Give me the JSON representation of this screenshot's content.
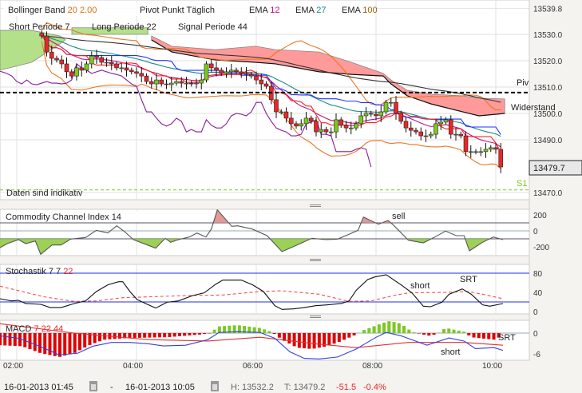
{
  "legend": {
    "bollinger_label": "Bollinger Band",
    "bollinger_period": "20",
    "bollinger_dev": "2.00",
    "pivot_label": "Pivot Punkt  Täglich",
    "ema1_label": "EMA",
    "ema1_value": "12",
    "ema2_label": "EMA",
    "ema2_value": "27",
    "ema3_label": "EMA",
    "ema3_value": "100",
    "short_label": "Short Periode",
    "short_value": "7",
    "long_label": "Long Periode",
    "long_value": "22",
    "signal_label": "Signal Periode",
    "signal_value": "44"
  },
  "annotations": {
    "piv": "Piv",
    "widerstand": "Widerstand",
    "s1": "S1",
    "indicative": "Daten sind indikativ",
    "cci_sell": "sell",
    "stoch_short": "short",
    "stoch_srt": "SRT",
    "macd_srt": "SRT",
    "macd_short": "short"
  },
  "panels": {
    "cci_title": "Commodity Channel Index",
    "cci_period": "14",
    "stoch_title": "Stochastik",
    "stoch_p1": "7",
    "stoch_p2": "7",
    "stoch_p3": "22",
    "macd_title": "MACD",
    "macd_p1": "7",
    "macd_p2": "22",
    "macd_p3": "44"
  },
  "footer": {
    "from": "16-01-2013 01:45",
    "separator": "-",
    "to": "16-01-2013 10:05",
    "high": "H: 13532.2",
    "low": "T: 13479.2",
    "change": "-51.5",
    "change_pct": "-0.4%"
  },
  "colors": {
    "up": "#7cc81e",
    "down": "#e8262a",
    "bollinger": "#e87722",
    "ema12": "#c0157e",
    "ema27": "#1a8a8a",
    "ema100": "#333333",
    "chikou": "#8a1a9a",
    "tenkan": "#ff2020",
    "kijun": "#2030ff",
    "cloud_bear": "#ff9a9a",
    "cloud_bull": "#b5e08a"
  },
  "chart_data": {
    "type": "candlestick",
    "x_ticks": [
      "02:00",
      "04:00",
      "06:00",
      "08:00",
      "10:00"
    ],
    "x_tick_hours": [
      2,
      4,
      6,
      8,
      10
    ],
    "price": {
      "y_ticks": [
        "13539.8",
        "13530.0",
        "13520.0",
        "13510.0",
        "13500.0",
        "13490.0",
        "13470.0"
      ],
      "y_tick_values": [
        13539.8,
        13530,
        13520,
        13510,
        13500,
        13490,
        13470
      ],
      "last_price": "13479.7",
      "start_hour": 2.4167,
      "step_minutes": 5,
      "closes": [
        13529.4,
        13523.3,
        13520.9,
        13520.3,
        13518.8,
        13515.8,
        13514.2,
        13517.3,
        13516.4,
        13518.8,
        13521.8,
        13521.2,
        13519.4,
        13519.4,
        13518.8,
        13517.3,
        13517.3,
        13516.4,
        13515.8,
        13515.2,
        13514.2,
        13512.1,
        13511.2,
        13512.7,
        13511.2,
        13510.9,
        13511.5,
        13512.1,
        13511.5,
        13511.5,
        13511.2,
        13511.5,
        13512.7,
        13518.8,
        13517.3,
        13516.4,
        13515.2,
        13515.8,
        13516.4,
        13515.8,
        13515.2,
        13514.8,
        13514.2,
        13512.7,
        13511.2,
        13510.3,
        13505.2,
        13500.6,
        13500.6,
        13498.2,
        13496.1,
        13495.2,
        13496.1,
        13498.2,
        13497.0,
        13493.0,
        13493.9,
        13493.0,
        13493.0,
        13497.6,
        13495.5,
        13494.5,
        13494.5,
        13496.1,
        13499.1,
        13500.0,
        13499.7,
        13499.1,
        13500.6,
        13504.2,
        13504.2,
        13500.0,
        13497.0,
        13494.5,
        13493.6,
        13493.0,
        13491.5,
        13491.5,
        13492.1,
        13496.1,
        13496.7,
        13497.6,
        13492.1,
        13492.1,
        13491.5,
        13485.5,
        13485.5,
        13485.5,
        13485.5,
        13486.4,
        13487.0,
        13486.4,
        13479.7
      ],
      "pivot": 13507.9,
      "s1": 13471.0,
      "cloud_bull": [
        [
          1.72,
          13531.5,
          13516.4
        ],
        [
          2.25,
          13531.5,
          13519.4
        ],
        [
          2.72,
          13529.4,
          13526.4
        ],
        [
          2.81,
          13527.9,
          13527.9
        ]
      ],
      "cloud_bull_strip": [
        [
          2.92,
          13532.5,
          13530.0
        ],
        [
          4.19,
          13532.5,
          13530.0
        ]
      ],
      "cloud_bear": [
        [
          4.25,
          13529.4,
          13527.9
        ],
        [
          4.59,
          13525.5,
          13523.3
        ],
        [
          5.32,
          13524.2,
          13520.3
        ],
        [
          5.99,
          13525.5,
          13519.4
        ],
        [
          6.32,
          13524.2,
          13518.8
        ],
        [
          7.05,
          13523.3,
          13515.8
        ],
        [
          7.59,
          13519.4,
          13514.8
        ],
        [
          8.12,
          13515.2,
          13514.2
        ],
        [
          8.25,
          13512.7,
          13511.2
        ],
        [
          8.52,
          13508.8,
          13506.7
        ],
        [
          8.92,
          13507.3,
          13503.6
        ],
        [
          9.45,
          13506.7,
          13500.6
        ],
        [
          9.72,
          13505.8,
          13499.1
        ],
        [
          10.15,
          13505.5,
          13500.0
        ]
      ]
    },
    "cci": {
      "y_ticks": [
        "200",
        "0",
        "-200"
      ],
      "y_tick_values": [
        200,
        0,
        -200
      ],
      "levels": [
        100,
        -100
      ],
      "t": [
        1.72,
        1.84,
        2.03,
        2.15,
        2.31,
        2.4,
        2.59,
        2.74,
        2.9,
        3.15,
        3.33,
        3.52,
        3.67,
        3.8,
        3.95,
        4.32,
        4.48,
        4.57,
        4.7,
        4.88,
        5.01,
        5.16,
        5.25,
        5.35,
        5.59,
        5.69,
        5.93,
        6.18,
        6.43,
        6.68,
        6.93,
        7.17,
        7.36,
        7.55,
        7.7,
        7.79,
        8.04,
        8.2,
        8.29,
        8.54,
        8.79,
        8.97,
        9.16,
        9.34,
        9.47,
        9.56,
        9.78,
        9.96,
        10.12
      ],
      "values": [
        -210,
        -160,
        -110,
        -160,
        -127,
        -293,
        -177,
        -177,
        -103,
        -83,
        7,
        -27,
        63,
        -10,
        -110,
        -217,
        -93,
        -143,
        -110,
        -77,
        -27,
        -77,
        23,
        263,
        57,
        63,
        23,
        -60,
        -260,
        -177,
        -93,
        -110,
        -103,
        -43,
        7,
        173,
        83,
        130,
        73,
        -117,
        -150,
        -83,
        -3,
        -60,
        -60,
        -250,
        -143,
        -77,
        -110
      ]
    },
    "stochastic": {
      "y_ticks": [
        "80",
        "40",
        "0"
      ],
      "y_tick_values": [
        80,
        40,
        0
      ],
      "levels": [
        80,
        20
      ],
      "k_t": [
        1.72,
        1.91,
        2.03,
        2.15,
        2.4,
        2.56,
        2.74,
        2.96,
        3.15,
        3.33,
        3.52,
        3.7,
        3.77,
        3.89,
        4.01,
        4.2,
        4.32,
        4.51,
        4.7,
        4.94,
        5.13,
        5.32,
        5.44,
        5.63,
        5.75,
        5.94,
        6.12,
        6.31,
        6.43,
        6.62,
        6.8,
        6.99,
        7.18,
        7.42,
        7.55,
        7.67,
        7.86,
        7.98,
        8.17,
        8.42,
        8.6,
        8.79,
        8.91,
        9.1,
        9.22,
        9.44,
        9.59,
        9.78,
        9.9,
        10.12
      ],
      "k": [
        26.7,
        22.2,
        23.3,
        16.7,
        15,
        8.3,
        8.3,
        16.7,
        22.2,
        41.7,
        55.6,
        62.2,
        62.2,
        41.7,
        25,
        13.9,
        7.2,
        19.4,
        22.2,
        33.3,
        38.9,
        56.7,
        65.6,
        65.6,
        65.6,
        55.6,
        41.7,
        12.2,
        4.4,
        5.6,
        8.3,
        12.2,
        13.9,
        16.7,
        22.2,
        44.4,
        66.7,
        72.2,
        76.7,
        55.6,
        38.9,
        11.1,
        10,
        19.4,
        36.1,
        47.2,
        36.1,
        13.9,
        11.1,
        16.7
      ],
      "d_t": [
        1.72,
        2.09,
        2.46,
        2.96,
        3.33,
        3.77,
        4.2,
        4.82,
        5.44,
        6.06,
        6.43,
        7.05,
        7.55,
        7.92,
        8.29,
        8.54,
        9.16,
        9.53,
        9.78,
        10.12
      ],
      "d": [
        52.8,
        41.7,
        30.6,
        21.1,
        22.2,
        28.9,
        30.6,
        33.3,
        34.4,
        41.7,
        43.3,
        36.1,
        21.1,
        22.2,
        33.3,
        38.9,
        40,
        41.7,
        36.1,
        26.7
      ]
    },
    "macd": {
      "y_ticks": [
        "0",
        "-6"
      ],
      "y_tick_values": [
        0,
        -6
      ],
      "hist_t": [
        1.72,
        2.09,
        2.4,
        2.71,
        2.96,
        3.21,
        3.46,
        3.89,
        4.51,
        5.07,
        5.25,
        5.35,
        5.69,
        6.06,
        6.25,
        6.43,
        6.68,
        6.93,
        7.18,
        7.42,
        7.67,
        7.8,
        8.11,
        8.23,
        8.42,
        8.6,
        8.73,
        8.91,
        9.04,
        9.16,
        9.47,
        9.59,
        9.97,
        10.12
      ],
      "hist": [
        -3.5,
        -3.8,
        -5.8,
        -6.9,
        -5.8,
        -3.5,
        -1.9,
        -1.4,
        -1.2,
        -0.4,
        0,
        1.9,
        2.3,
        1.5,
        0.4,
        -1.9,
        -4.2,
        -4.6,
        -3.8,
        -2.3,
        -0.4,
        0.9,
        2.9,
        3.5,
        2.7,
        0.4,
        -0.2,
        -0.8,
        0,
        1.5,
        0.4,
        -1.2,
        -1.9,
        -0.8
      ],
      "macd_t": [
        1.72,
        2.03,
        2.34,
        2.71,
        3.02,
        3.27,
        3.58,
        3.89,
        4.2,
        4.45,
        4.82,
        5.19,
        5.38,
        5.69,
        6.06,
        6.31,
        6.56,
        6.8,
        7.05,
        7.36,
        7.67,
        7.98,
        8.17,
        8.42,
        8.85,
        9.22,
        9.47,
        9.66,
        9.97,
        10.12
      ],
      "macd": [
        -0.8,
        -1.5,
        -3.5,
        -6.3,
        -5.8,
        -3.8,
        -2.7,
        -2.7,
        -3.1,
        -3.7,
        -3.5,
        -1.9,
        0.2,
        0.4,
        0.2,
        -1.5,
        -5.4,
        -7.3,
        -7.5,
        -6.9,
        -4.6,
        -1.4,
        0.2,
        -0.8,
        -3.5,
        -1.4,
        -2.3,
        -4.5,
        -4.2,
        -5
      ],
      "signal_t": [
        1.72,
        2.96,
        4.2,
        5.19,
        6.06,
        6.99,
        7.67,
        8.54,
        9.47,
        10.12
      ],
      "signal": [
        2.7,
        0,
        -1.9,
        -2.3,
        -1.2,
        -3.1,
        -4.2,
        -2.7,
        -2.7,
        -3.5
      ]
    }
  }
}
